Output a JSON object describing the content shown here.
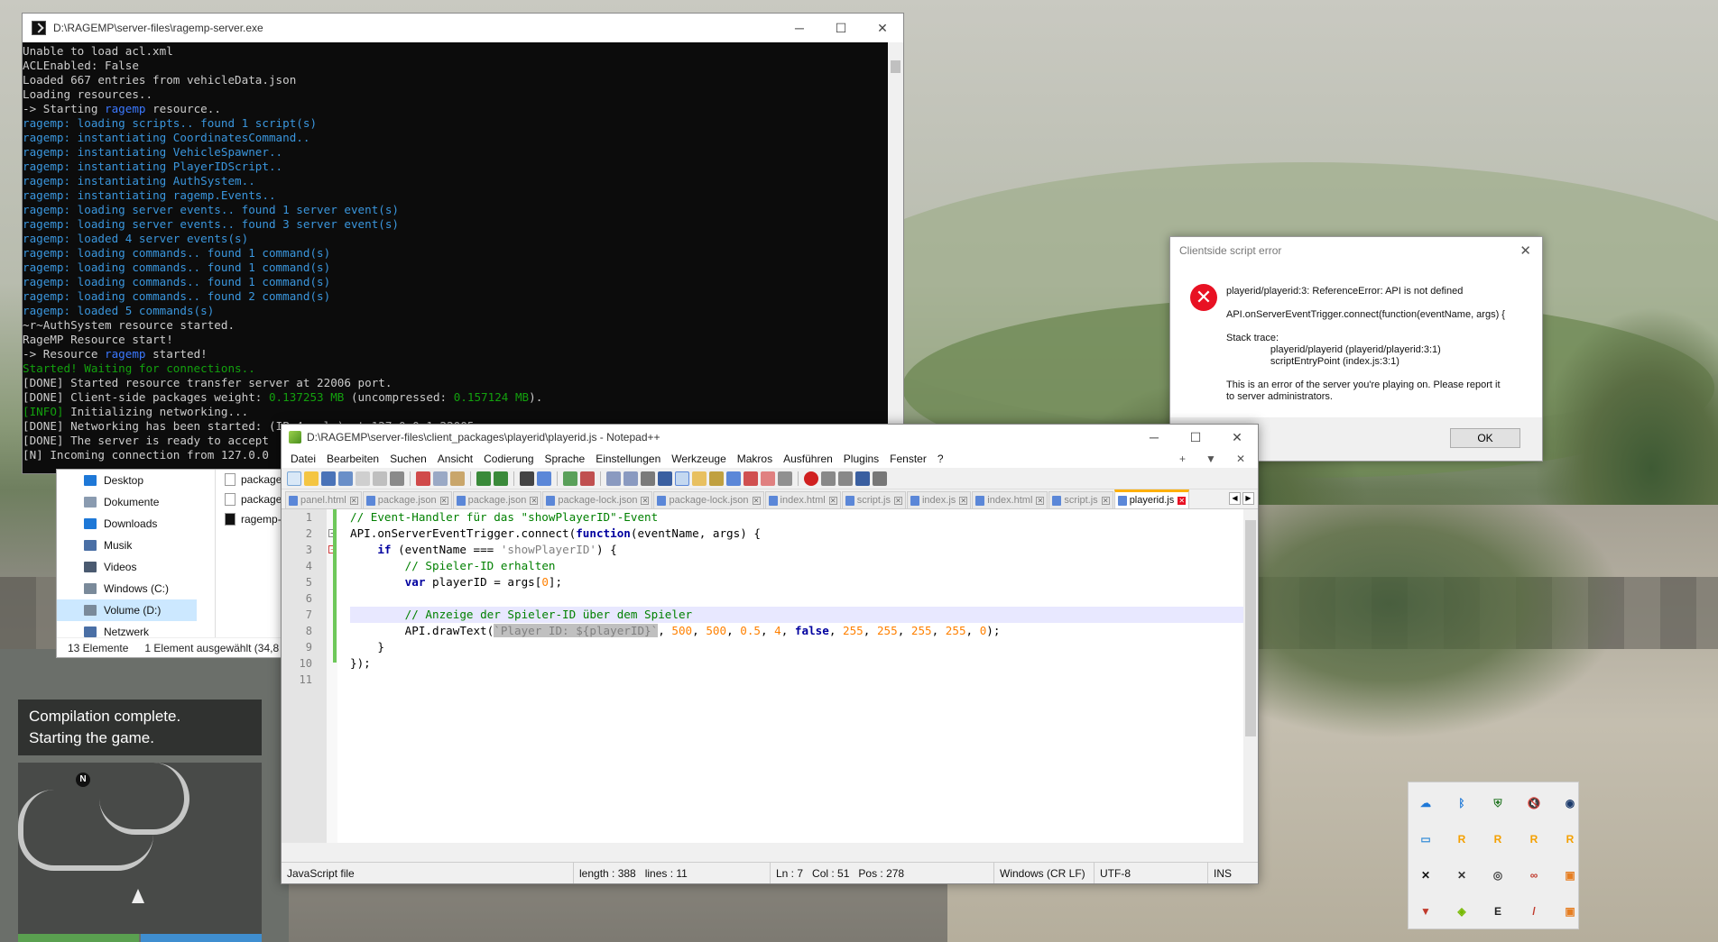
{
  "console": {
    "title": "D:\\RAGEMP\\server-files\\ragemp-server.exe",
    "lines": [
      [
        {
          "t": "Unable to load acl.xml"
        }
      ],
      [
        {
          "t": "ACLEnabled: False"
        }
      ],
      [
        {
          "t": "Loaded 667 entries from vehicleData.json"
        }
      ],
      [
        {
          "t": "Loading resources.."
        }
      ],
      [
        {
          "t": "-> Starting "
        },
        {
          "t": "ragemp",
          "c": "c-b"
        },
        {
          "t": " resource.."
        }
      ],
      [
        {
          "t": "ragemp:",
          "c": "c-t"
        },
        {
          "t": " loading scripts.. found 1 script(s)",
          "c": "c-t"
        }
      ],
      [
        {
          "t": "ragemp:",
          "c": "c-t"
        },
        {
          "t": " instantiating CoordinatesCommand..",
          "c": "c-t"
        }
      ],
      [
        {
          "t": "ragemp:",
          "c": "c-t"
        },
        {
          "t": " instantiating VehicleSpawner..",
          "c": "c-t"
        }
      ],
      [
        {
          "t": "ragemp:",
          "c": "c-t"
        },
        {
          "t": " instantiating PlayerIDScript..",
          "c": "c-t"
        }
      ],
      [
        {
          "t": "ragemp:",
          "c": "c-t"
        },
        {
          "t": " instantiating AuthSystem..",
          "c": "c-t"
        }
      ],
      [
        {
          "t": "ragemp:",
          "c": "c-t"
        },
        {
          "t": " instantiating ragemp.Events..",
          "c": "c-t"
        }
      ],
      [
        {
          "t": "ragemp:",
          "c": "c-t"
        },
        {
          "t": " loading server events.. found 1 server event(s)",
          "c": "c-t"
        }
      ],
      [
        {
          "t": "ragemp:",
          "c": "c-t"
        },
        {
          "t": " loading server events.. found 3 server event(s)",
          "c": "c-t"
        }
      ],
      [
        {
          "t": "ragemp:",
          "c": "c-t"
        },
        {
          "t": " loaded 4 server events(s)",
          "c": "c-t"
        }
      ],
      [
        {
          "t": "ragemp:",
          "c": "c-t"
        },
        {
          "t": " loading commands.. found 1 command(s)",
          "c": "c-t"
        }
      ],
      [
        {
          "t": "ragemp:",
          "c": "c-t"
        },
        {
          "t": " loading commands.. found 1 command(s)",
          "c": "c-t"
        }
      ],
      [
        {
          "t": "ragemp:",
          "c": "c-t"
        },
        {
          "t": " loading commands.. found 1 command(s)",
          "c": "c-t"
        }
      ],
      [
        {
          "t": "ragemp:",
          "c": "c-t"
        },
        {
          "t": " loading commands.. found 2 command(s)",
          "c": "c-t"
        }
      ],
      [
        {
          "t": "ragemp:",
          "c": "c-t"
        },
        {
          "t": " loaded 5 commands(s)",
          "c": "c-t"
        }
      ],
      [
        {
          "t": "~r~AuthSystem resource started."
        }
      ],
      [
        {
          "t": "RageMP Resource start!"
        }
      ],
      [
        {
          "t": "-> Resource "
        },
        {
          "t": "ragemp",
          "c": "c-b"
        },
        {
          "t": " started!"
        }
      ],
      [
        {
          "t": "Started! Waiting for connections..",
          "c": "c-g"
        }
      ],
      [
        {
          "t": "[DONE] Started resource transfer server at 22006 port."
        }
      ],
      [
        {
          "t": "[DONE] Client-side packages weight: "
        },
        {
          "t": "0.137253 MB",
          "c": "c-g"
        },
        {
          "t": " (uncompressed: "
        },
        {
          "t": "0.157124 MB",
          "c": "c-g"
        },
        {
          "t": ")."
        }
      ],
      [
        {
          "t": "[INFO]",
          "c": "c-g"
        },
        {
          "t": " Initializing networking..."
        }
      ],
      [
        {
          "t": "[DONE] Networking has been started: (IPv4 only) at 127.0.0.1:22005"
        }
      ],
      [
        {
          "t": "[DONE] The server is ready to accept"
        }
      ],
      [
        {
          "t": "[N] Incoming connection from 127.0.0"
        }
      ]
    ]
  },
  "explorer": {
    "nav": [
      {
        "label": "Desktop",
        "color": "#1e78d7"
      },
      {
        "label": "Dokumente",
        "color": "#8a9bb0"
      },
      {
        "label": "Downloads",
        "color": "#1e78d7"
      },
      {
        "label": "Musik",
        "color": "#4a6fa5"
      },
      {
        "label": "Videos",
        "color": "#4a5a70"
      },
      {
        "label": "Windows (C:)",
        "color": "#7a8a9a"
      },
      {
        "label": "Volume (D:)",
        "color": "#7a8a9a"
      },
      {
        "label": "Netzwerk",
        "color": "#4a6fa5"
      }
    ],
    "files": [
      "package.js",
      "package-l",
      "ragemp-s"
    ],
    "status_count": "13 Elemente",
    "status_selected": "1 Element ausgewählt (34,8 M"
  },
  "hud": {
    "line1": "Compilation complete.",
    "line2": "Starting the game.",
    "north": "N"
  },
  "error_dialog": {
    "title": "Clientside script error",
    "icon": "x-icon",
    "message": "playerid/playerid:3: ReferenceError: API is not defined\n\nAPI.onServerEventTrigger.connect(function(eventName, args) {\n\nStack trace:\n                playerid/playerid (playerid/playerid:3:1)\n                scriptEntryPoint (index.js:3:1)\n\nThis is an error of the server you're playing on. Please report it\nto server administrators.",
    "ok_label": "OK"
  },
  "notepad": {
    "title": "D:\\RAGEMP\\server-files\\client_packages\\playerid\\playerid.js - Notepad++",
    "menu": [
      "Datei",
      "Bearbeiten",
      "Suchen",
      "Ansicht",
      "Codierung",
      "Sprache",
      "Einstellungen",
      "Werkzeuge",
      "Makros",
      "Ausführen",
      "Plugins",
      "Fenster",
      "?"
    ],
    "menu_right": [
      "+",
      "▼",
      "✕"
    ],
    "tabs": [
      "panel.html",
      "package.json",
      "package.json",
      "package-lock.json",
      "package-lock.json",
      "index.html",
      "script.js",
      "index.js",
      "index.html",
      "script.js",
      "playerid.js"
    ],
    "active_tab": "playerid.js",
    "line_numbers": [
      "1",
      "2",
      "3",
      "4",
      "5",
      "6",
      "7",
      "8",
      "9",
      "10",
      "11"
    ],
    "code": [
      [
        {
          "t": "// Event-Handler für das \"showPlayerID\"-Event",
          "c": "cm"
        }
      ],
      [
        {
          "t": "API.onServerEventTrigger.connect("
        },
        {
          "t": "function",
          "c": "k"
        },
        {
          "t": "(eventName, args) {"
        }
      ],
      [
        {
          "t": "    "
        },
        {
          "t": "if",
          "c": "k"
        },
        {
          "t": " (eventName === "
        },
        {
          "t": "'showPlayerID'",
          "c": "s"
        },
        {
          "t": ") {"
        }
      ],
      [
        {
          "t": "        "
        },
        {
          "t": "// Spieler-ID erhalten",
          "c": "cm"
        }
      ],
      [
        {
          "t": "        "
        },
        {
          "t": "var",
          "c": "k"
        },
        {
          "t": " playerID = args["
        },
        {
          "t": "0",
          "c": "n"
        },
        {
          "t": "];"
        }
      ],
      [
        {
          "t": ""
        }
      ],
      [
        {
          "t": "        "
        },
        {
          "t": "// Anzeige der Spieler-ID über dem Spieler",
          "c": "cm"
        }
      ],
      [
        {
          "t": "        API.drawText("
        },
        {
          "t": "`Player ID: ${playerID}`",
          "c": "s sel"
        },
        {
          "t": ", "
        },
        {
          "t": "500",
          "c": "n"
        },
        {
          "t": ", "
        },
        {
          "t": "500",
          "c": "n"
        },
        {
          "t": ", "
        },
        {
          "t": "0.5",
          "c": "n"
        },
        {
          "t": ", "
        },
        {
          "t": "4",
          "c": "n"
        },
        {
          "t": ", "
        },
        {
          "t": "false",
          "c": "k"
        },
        {
          "t": ", "
        },
        {
          "t": "255",
          "c": "n"
        },
        {
          "t": ", "
        },
        {
          "t": "255",
          "c": "n"
        },
        {
          "t": ", "
        },
        {
          "t": "255",
          "c": "n"
        },
        {
          "t": ", "
        },
        {
          "t": "255",
          "c": "n"
        },
        {
          "t": ", "
        },
        {
          "t": "0",
          "c": "n"
        },
        {
          "t": ");"
        }
      ],
      [
        {
          "t": "    }"
        }
      ],
      [
        {
          "t": "});"
        }
      ],
      [
        {
          "t": ""
        }
      ]
    ],
    "status": {
      "filetype": "JavaScript file",
      "length": "length : 388",
      "lines": "lines : 11",
      "ln": "Ln : 7",
      "col": "Col : 51",
      "pos": "Pos : 278",
      "eol": "Windows (CR LF)",
      "encoding": "UTF-8",
      "mode": "INS"
    }
  },
  "tray": [
    {
      "name": "onedrive-icon",
      "glyph": "☁",
      "color": "#1e78d7"
    },
    {
      "name": "bluetooth-icon",
      "glyph": "ᛒ",
      "color": "#1e78d7"
    },
    {
      "name": "defender-icon",
      "glyph": "⛨",
      "color": "#2a7a2a"
    },
    {
      "name": "volume-muted-icon",
      "glyph": "🔇",
      "color": "#555"
    },
    {
      "name": "steam-icon",
      "glyph": "◉",
      "color": "#1b3a6b"
    },
    {
      "name": "display-icon",
      "glyph": "▭",
      "color": "#3a8fd8"
    },
    {
      "name": "rockstar-icon",
      "glyph": "R",
      "color": "#f4a000"
    },
    {
      "name": "rockstar-icon",
      "glyph": "R",
      "color": "#f4a000"
    },
    {
      "name": "rockstar-icon",
      "glyph": "R",
      "color": "#f4a000"
    },
    {
      "name": "rockstar-icon",
      "glyph": "R",
      "color": "#f4a000"
    },
    {
      "name": "x-app-icon",
      "glyph": "✕",
      "color": "#111"
    },
    {
      "name": "x-app-icon",
      "glyph": "✕",
      "color": "#333"
    },
    {
      "name": "camera-icon",
      "glyph": "◎",
      "color": "#444"
    },
    {
      "name": "creative-cloud-icon",
      "glyph": "∞",
      "color": "#c0392b"
    },
    {
      "name": "ragemp-icon",
      "glyph": "▣",
      "color": "#e67e22"
    },
    {
      "name": "vpn-icon",
      "glyph": "▼",
      "color": "#c0392b"
    },
    {
      "name": "nvidia-icon",
      "glyph": "◈",
      "color": "#76b900"
    },
    {
      "name": "epic-icon",
      "glyph": "E",
      "color": "#222"
    },
    {
      "name": "pen-icon",
      "glyph": "/",
      "color": "#c0392b"
    },
    {
      "name": "ragemp-icon",
      "glyph": "▣",
      "color": "#e67e22"
    }
  ]
}
